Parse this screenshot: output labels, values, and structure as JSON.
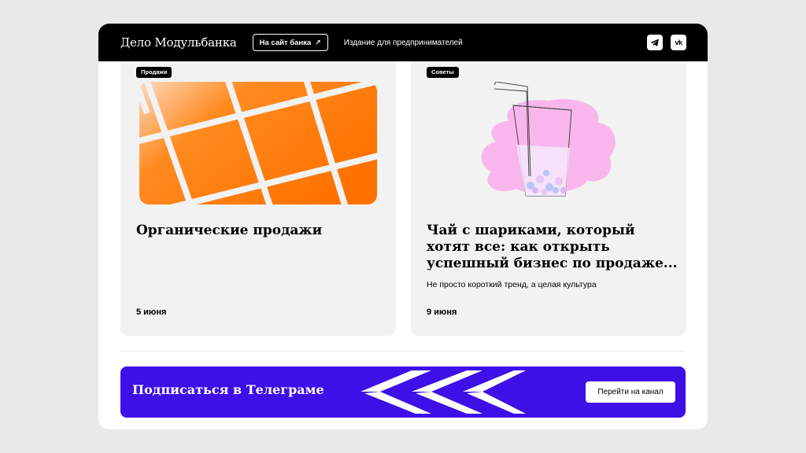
{
  "header": {
    "logo": "Дело Модульбанка",
    "bank_button": "На сайт банка",
    "bank_button_arrow": "↗",
    "tagline": "Издание для предпринимателей",
    "social": [
      {
        "icon": "telegram-icon"
      },
      {
        "icon": "vk-icon",
        "label": "vk"
      }
    ]
  },
  "cards": [
    {
      "tag": "Продажи",
      "title": "Органические продажи",
      "subtitle": "",
      "date": "5 июня",
      "image": "orange-tiles-illustration"
    },
    {
      "tag": "Советы",
      "title": "Чай с шариками, который хотят все: как открыть успешный бизнес по продаже...",
      "subtitle": "Не просто короткий тренд, а целая культура",
      "date": "9 июня",
      "image": "bubble-tea-illustration"
    }
  ],
  "banner": {
    "title": "Подписаться в Телеграме",
    "button": "Перейти на канал"
  },
  "colors": {
    "header_bg": "#000000",
    "card_bg": "#f2f2f2",
    "accent_orange": "#ff7a00",
    "banner_blue": "#3e0fe6",
    "pink": "#f9b6ec"
  }
}
